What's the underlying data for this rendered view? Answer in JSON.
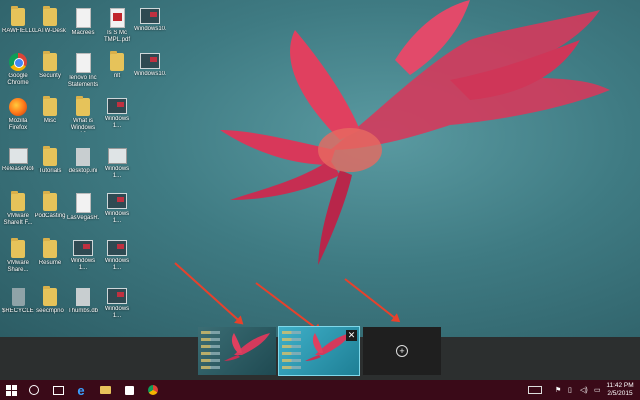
{
  "desktop": {
    "icons": [
      {
        "type": "folder",
        "label": "RAWFIELLO"
      },
      {
        "type": "chrome",
        "label": "Google Chrome"
      },
      {
        "type": "firefox",
        "label": "Mozilla Firefox"
      },
      {
        "type": "win",
        "label": "ReleaseNotes"
      },
      {
        "type": "folder",
        "label": "VMware ShareIt F..."
      },
      {
        "type": "folder",
        "label": "VMware Share..."
      },
      {
        "type": "trash",
        "label": "$RECYCLE..."
      },
      {
        "type": "folder",
        "label": "LATW-Desk"
      },
      {
        "type": "folder",
        "label": "Security"
      },
      {
        "type": "folder",
        "label": "Misc"
      },
      {
        "type": "folder",
        "label": "Tutorials"
      },
      {
        "type": "folder",
        "label": "PodCasting"
      },
      {
        "type": "folder",
        "label": "Resume"
      },
      {
        "type": "folder",
        "label": "seecmpno"
      },
      {
        "type": "doc",
        "label": "Macrees"
      },
      {
        "type": "doc",
        "label": "lenovo Inc Statements"
      },
      {
        "type": "folder",
        "label": "What is Windows 10"
      },
      {
        "type": "link",
        "label": "desktop.ini"
      },
      {
        "type": "doc",
        "label": "LasVegasR..."
      },
      {
        "type": "shot",
        "label": "Windows 1..."
      },
      {
        "type": "link",
        "label": "Thumbs.db"
      },
      {
        "type": "pdf",
        "label": "Is S Mc TMPL.pdf"
      },
      {
        "type": "folder",
        "label": "nlt"
      },
      {
        "type": "shot",
        "label": "Windows 1..."
      },
      {
        "type": "win",
        "label": "Windows 1..."
      },
      {
        "type": "shot",
        "label": "Windows 1..."
      },
      {
        "type": "shot",
        "label": "Windows 1..."
      },
      {
        "type": "shot",
        "label": "Windows 1..."
      },
      {
        "type": "shot",
        "label": "Windows10..."
      },
      {
        "type": "shot",
        "label": "Windows10..."
      }
    ]
  },
  "task_view": {
    "desktops": [
      {
        "name": "desktop-1",
        "active": false
      },
      {
        "name": "desktop-2",
        "active": true,
        "close_label": "✕"
      }
    ],
    "add_desktop_label": "+"
  },
  "taskbar": {
    "ie_glyph": "e",
    "clock": {
      "time": "11:42 PM",
      "date": "2/5/2015"
    }
  },
  "colors": {
    "taskbar": "#3a0a18",
    "arrow": "#e8412b",
    "task_view_band": "#2b2b2b"
  }
}
